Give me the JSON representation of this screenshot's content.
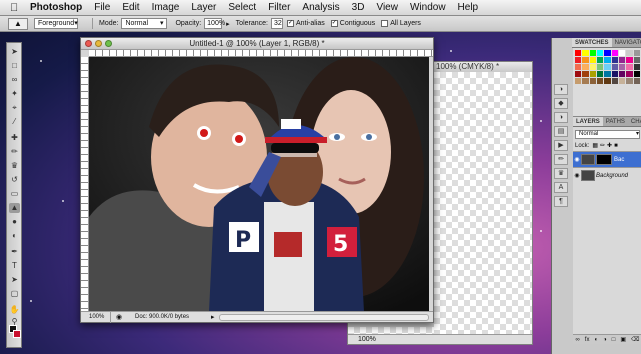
{
  "menubar": {
    "apple": "",
    "items": [
      "Photoshop",
      "File",
      "Edit",
      "Image",
      "Layer",
      "Select",
      "Filter",
      "Analysis",
      "3D",
      "View",
      "Window",
      "Help"
    ]
  },
  "options": {
    "sample_mode": "Foreground",
    "mode_label": "Mode:",
    "mode_value": "Normal",
    "opacity_label": "Opacity:",
    "opacity_value": "100%",
    "tolerance_label": "Tolerance:",
    "tolerance_value": "32",
    "antialias": "Anti-alias",
    "contiguous": "Contiguous",
    "all_layers": "All Layers"
  },
  "doc_main": {
    "title": "Untitled-1 @ 100% (Layer 1, RGB/8) *",
    "zoom": "100%",
    "doc_size": "Doc: 900.0K/0 bytes"
  },
  "doc_back": {
    "title": "100% (CMYK/8) *",
    "zoom": "100%"
  },
  "panels": {
    "swatch_tabs": [
      "SWATCHES",
      "NAVIGATOR"
    ],
    "layer_tabs": [
      "LAYERS",
      "PATHS",
      "CHANN"
    ],
    "blend_mode": "Normal",
    "lock_label": "Lock:",
    "layers": [
      {
        "name": "Bac",
        "selected": true
      },
      {
        "name": "Background",
        "selected": false
      }
    ],
    "swatch_colors": [
      "#ff0000",
      "#ffff00",
      "#00ff00",
      "#00ffff",
      "#0000ff",
      "#ff00ff",
      "#ffffff",
      "#cccccc",
      "#999999",
      "#ee1d24",
      "#f7941d",
      "#fff200",
      "#00a651",
      "#00aeef",
      "#2e3192",
      "#92278f",
      "#ec008c",
      "#666666",
      "#f26c4f",
      "#fbaf5d",
      "#fff568",
      "#7cc576",
      "#6dcff6",
      "#605ca8",
      "#a864a8",
      "#f06ea9",
      "#333333",
      "#9e0b0f",
      "#a0410d",
      "#aba000",
      "#007236",
      "#0076a3",
      "#1b1464",
      "#630460",
      "#9e005d",
      "#000000",
      "#c69c6d",
      "#a67c52",
      "#8c6239",
      "#754c24",
      "#603913",
      "#534741",
      "#c7b299",
      "#998675",
      "#736357"
    ]
  }
}
